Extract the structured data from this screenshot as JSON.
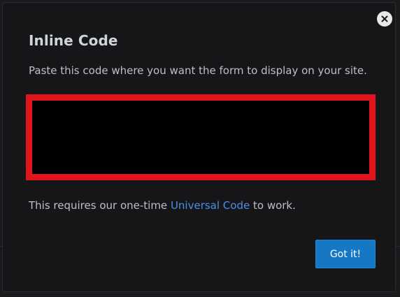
{
  "dialog": {
    "title": "Inline Code",
    "instruction": "Paste this code where you want the form to display on your site.",
    "code_value": "",
    "footnote": {
      "prefix": "This requires our one-time ",
      "link_text": "Universal Code",
      "suffix": " to work."
    },
    "confirm_label": "Got it!",
    "close_icon": "close-icon"
  },
  "colors": {
    "background": "#161618",
    "title": "#cfd5dc",
    "text": "#b9c0c8",
    "link": "#4c8fe8",
    "highlight_border": "#e0141c",
    "button": "#1677c4"
  }
}
